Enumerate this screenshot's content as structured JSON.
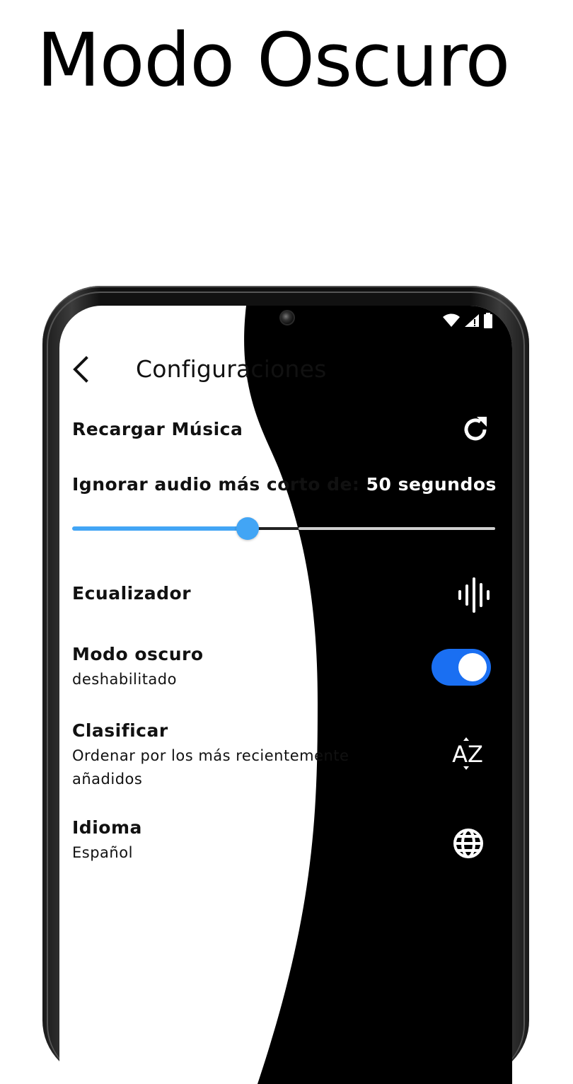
{
  "promo": {
    "title": "Modo Oscuro"
  },
  "header": {
    "title": "Configuraciones"
  },
  "settings": {
    "reload": {
      "label": "Recargar Música"
    },
    "ignore": {
      "label_prefix": "Ignorar audio más corto de: ",
      "label_value": "50 segundos",
      "slider_value_fraction": 0.415
    },
    "equalizer": {
      "label": "Ecualizador"
    },
    "dark_mode": {
      "label": "Modo oscuro",
      "status": "deshabilitado",
      "enabled": true
    },
    "sort": {
      "label": "Clasificar",
      "description": "Ordenar por los más recientemente añadidos",
      "icon_text": "AZ"
    },
    "language": {
      "label": "Idioma",
      "value": "Español"
    }
  },
  "colors": {
    "accent": "#42a5f5",
    "toggle_on": "#1a6ff2",
    "background_light": "#ffffff",
    "background_dark": "#000000"
  },
  "icons": [
    "chevron-left-icon",
    "refresh-icon",
    "sound-wave-icon",
    "toggle-switch",
    "sort-az-icon",
    "globe-icon",
    "wifi-icon",
    "signal-icon",
    "battery-icon"
  ]
}
